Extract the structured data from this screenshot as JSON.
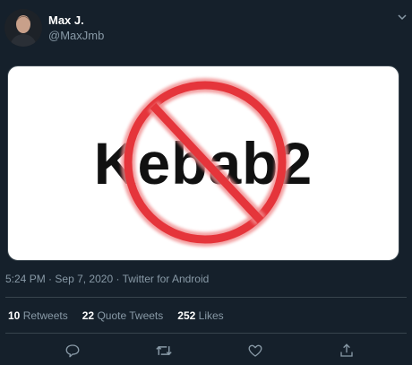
{
  "author": {
    "name": "Max J.",
    "handle": "@MaxJmb"
  },
  "media": {
    "text": "Kebab2"
  },
  "meta": {
    "time": "5:24 PM",
    "date": "Sep 7, 2020",
    "source": "Twitter for Android",
    "separator": "·"
  },
  "stats": {
    "retweets_count": "10",
    "retweets_label": "Retweets",
    "quote_count": "22",
    "quote_label": "Quote Tweets",
    "likes_count": "252",
    "likes_label": "Likes"
  },
  "icons": {
    "reply": "reply-icon",
    "retweet": "retweet-icon",
    "like": "heart-icon",
    "share": "share-icon",
    "more": "chevron-down-icon"
  },
  "colors": {
    "background": "#15202b",
    "muted": "#8899a6",
    "divider": "#38444d",
    "prohibition": "#e8343a"
  }
}
